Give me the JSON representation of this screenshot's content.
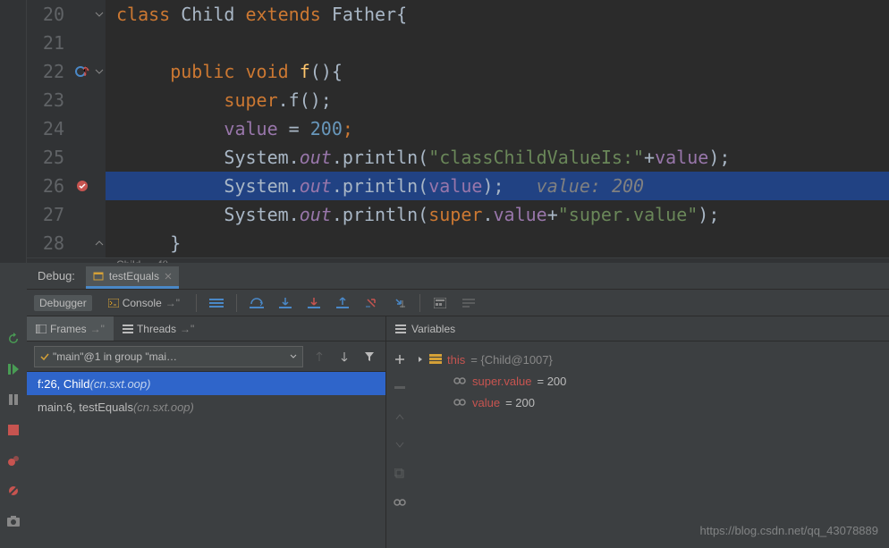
{
  "editor": {
    "lines": [
      {
        "num": "20"
      },
      {
        "num": "21"
      },
      {
        "num": "22"
      },
      {
        "num": "23"
      },
      {
        "num": "24"
      },
      {
        "num": "25"
      },
      {
        "num": "26"
      },
      {
        "num": "27"
      },
      {
        "num": "28"
      }
    ],
    "tokens": {
      "l20_class": "class ",
      "l20_child": "Child ",
      "l20_extends": "extends ",
      "l20_father": "Father",
      "l20_brace": "{",
      "l22_public": "public ",
      "l22_void": "void ",
      "l22_f": "f",
      "l22_paren": "(){",
      "l23_super": "super",
      "l23_dotf": ".f();",
      "l24_value": "value ",
      "l24_eq": "= ",
      "l24_200": "200",
      "l24_semi": ";",
      "l25_system": "System.",
      "l25_out": "out",
      "l25_print": ".println(",
      "l25_str": "\"classChildValueIs:\"",
      "l25_plus": "+",
      "l25_value": "value",
      "l25_end": ");",
      "l26_system": "System.",
      "l26_out": "out",
      "l26_print": ".println(",
      "l26_value": "value",
      "l26_end": ");",
      "l26_hint": "   value: 200",
      "l27_system": "System.",
      "l27_out": "out",
      "l27_print": ".println(",
      "l27_super": "super",
      "l27_dotval": ".",
      "l27_val": "value",
      "l27_plus": "+",
      "l27_str": "\"super.value\"",
      "l27_end": ");",
      "l28_brace": "}"
    }
  },
  "breadcrumb": {
    "c1": "Child",
    "sep": "›",
    "c2": "f()"
  },
  "debug": {
    "label": "Debug:",
    "tab": "testEquals",
    "toolbar": {
      "debugger": "Debugger",
      "console": "Console"
    },
    "frames": {
      "tab1": "Frames",
      "tab2": "Threads",
      "combo": "\"main\"@1 in group \"mai…",
      "item1_a": "f:26, Child ",
      "item1_b": "(cn.sxt.oop)",
      "item2_a": "main:6, testEquals ",
      "item2_b": "(cn.sxt.oop)"
    },
    "vars": {
      "title": "Variables",
      "this_key": "this",
      "this_val": " = {Child@1007}",
      "super_key": "super.value",
      "super_val": " = 200",
      "value_key": "value",
      "value_val": " = 200"
    }
  },
  "watermark": "https://blog.csdn.net/qq_43078889"
}
